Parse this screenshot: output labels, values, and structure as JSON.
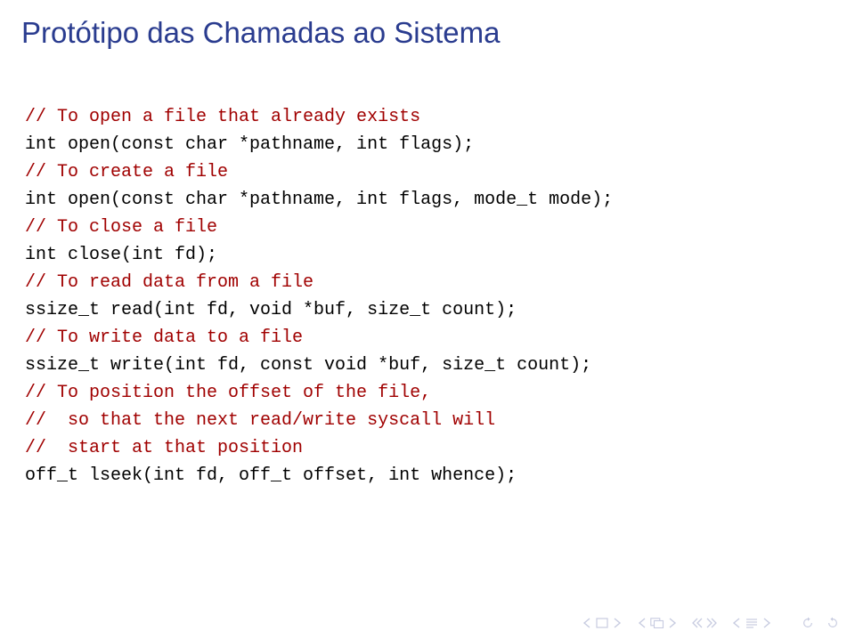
{
  "title": "Protótipo das Chamadas ao Sistema",
  "code": {
    "lines": [
      {
        "t": "comment",
        "v": "// To open a file that already exists"
      },
      {
        "t": "code",
        "v": "int open(const char *pathname, int flags);"
      },
      {
        "t": "comment",
        "v": "// To create a file"
      },
      {
        "t": "code",
        "v": "int open(const char *pathname, int flags, mode_t mode);"
      },
      {
        "t": "comment",
        "v": "// To close a file"
      },
      {
        "t": "code",
        "v": "int close(int fd);"
      },
      {
        "t": "comment",
        "v": "// To read data from a file"
      },
      {
        "t": "code",
        "v": "ssize_t read(int fd, void *buf, size_t count);"
      },
      {
        "t": "comment",
        "v": "// To write data to a file"
      },
      {
        "t": "code",
        "v": "ssize_t write(int fd, const void *buf, size_t count);"
      },
      {
        "t": "comment",
        "v": "// To position the offset of the file,"
      },
      {
        "t": "comment",
        "v": "//  so that the next read/write syscall will"
      },
      {
        "t": "comment",
        "v": "//  start at that position"
      },
      {
        "t": "code",
        "v": "off_t lseek(int fd, off_t offset, int whence);"
      }
    ]
  },
  "nav": {
    "color_faded": "#c7cbe0",
    "color_dark": "#9aa2c8"
  }
}
